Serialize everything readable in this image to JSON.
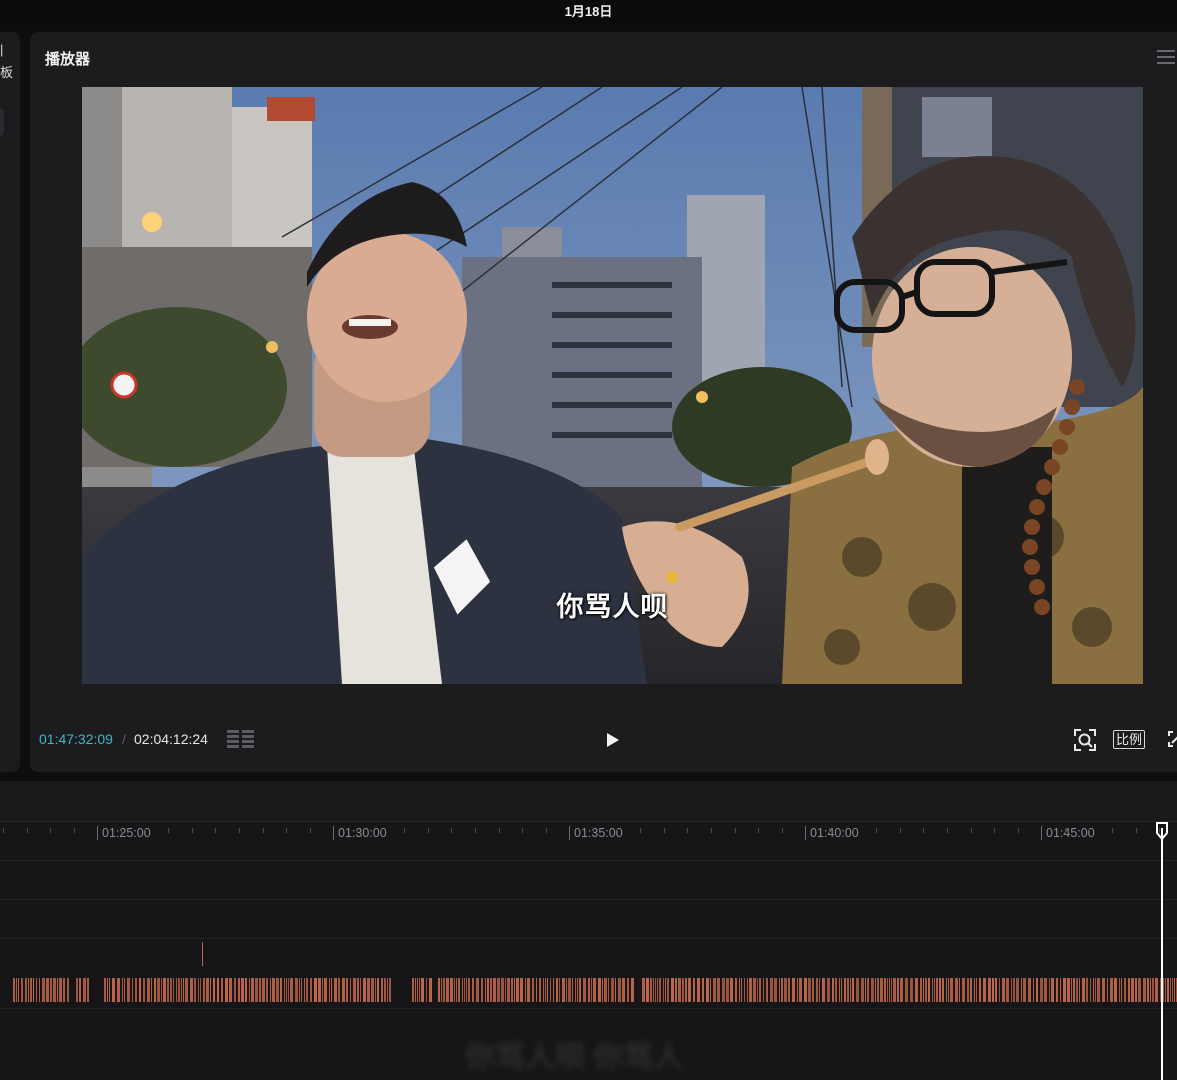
{
  "topbar": {
    "date": "1月18日"
  },
  "left_panel": {
    "stub_a": "|",
    "stub_b": "板"
  },
  "player": {
    "title": "播放器",
    "subtitle": "你骂人呗",
    "time_current": "01:47:32:09",
    "time_separator": "/",
    "time_total": "02:04:12:24",
    "ratio_label": "比例",
    "accent_color": "#3bb7c9"
  },
  "timeline": {
    "ruler_labels": [
      "01:25:00",
      "01:30:00",
      "01:35:00",
      "01:40:00",
      "01:45:00"
    ],
    "audio_color": "#c0684a",
    "blurred_caption": "你骂人呗 你骂人"
  },
  "icons": [
    "menu-icon",
    "grid-icon",
    "play-icon",
    "focus-icon",
    "fullscreen-icon",
    "playhead-icon"
  ]
}
